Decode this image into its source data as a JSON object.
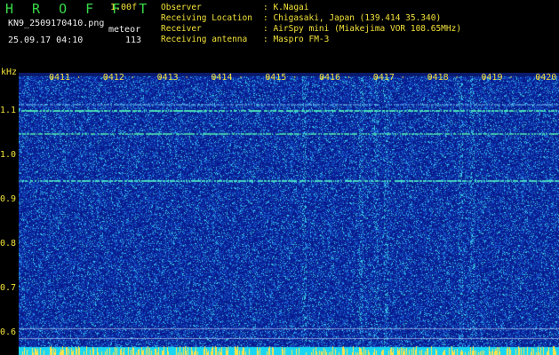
{
  "header": {
    "app_title": "H R O F F T",
    "version": "1.00f",
    "filename": "KN9_2509170410.png",
    "mode_label": "meteor",
    "datetime": "25.09.17 04:10",
    "count": "113"
  },
  "info": [
    {
      "label": "Observer",
      "value": ": K.Nagai"
    },
    {
      "label": "Receiving Location",
      "value": ": Chigasaki, Japan (139.414 35.340)"
    },
    {
      "label": "Receiver",
      "value": ": AirSpy mini (Miakejima VOR 108.65MHz)"
    },
    {
      "label": "Receiving antenna",
      "value": ": Maspro FM-3"
    }
  ],
  "spectrogram": {
    "unit": "kHz",
    "y_ticks": [
      "1.1",
      "1.0",
      "0.9",
      "0.8",
      "0.7",
      "0.6"
    ],
    "time_labels": [
      "0411",
      "0412",
      "0413",
      "0414",
      "0415",
      "0416",
      "0417",
      "0418",
      "0419",
      "0420"
    ],
    "colors": {
      "background": "#0a1d8c",
      "noise": "#1f5fe0",
      "signal": "#3cf2c0",
      "floor": "#1ad7f5"
    }
  }
}
